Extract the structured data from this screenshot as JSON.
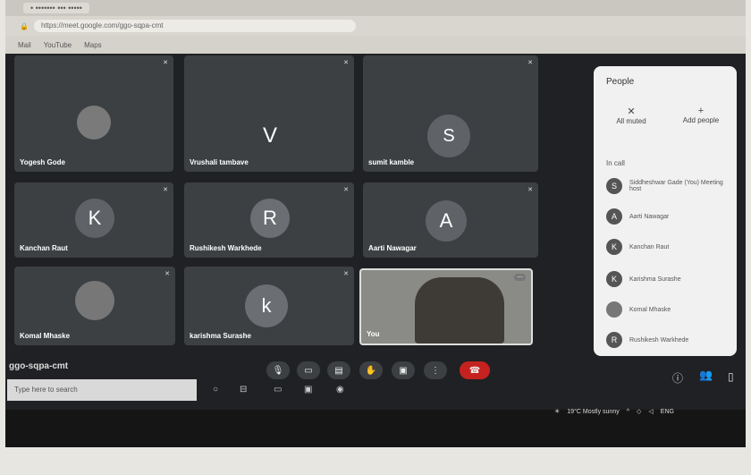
{
  "browser": {
    "tab_title": "• ••••••• ••• •••••",
    "address": "https://meet.google.com/ggo-sqpa-cmt",
    "bookmarks": [
      "Mail",
      "YouTube",
      "Maps"
    ]
  },
  "tiles": [
    {
      "name": "Yogesh Gode",
      "initial": ""
    },
    {
      "name": "Vrushali tambave",
      "initial": "V"
    },
    {
      "name": "sumit kamble",
      "initial": "S"
    },
    {
      "name": "Kanchan Raut",
      "initial": "K"
    },
    {
      "name": "Rushikesh Warkhede",
      "initial": "R"
    },
    {
      "name": "Aarti Nawagar",
      "initial": "A"
    },
    {
      "name": "Komal Mhaske",
      "initial": ""
    },
    {
      "name": "karishma Surashe",
      "initial": "k"
    },
    {
      "name": "You",
      "initial": ""
    }
  ],
  "people_panel": {
    "title": "People",
    "mute_all": "All muted",
    "add_people": "Add people",
    "in_call": "In call",
    "participants": [
      {
        "initial": "S",
        "name": "Siddheshwar Gade (You) Meeting host"
      },
      {
        "initial": "A",
        "name": "Aarti Nawagar"
      },
      {
        "initial": "K",
        "name": "Kanchan Raut"
      },
      {
        "initial": "K",
        "name": "Karishma Surashe"
      },
      {
        "initial": "",
        "name": "Komal Mhaske"
      },
      {
        "initial": "R",
        "name": "Rushikesh Warkhede"
      }
    ]
  },
  "meeting": {
    "code": "ggo-sqpa-cmt"
  },
  "taskbar": {
    "search_placeholder": "Type here to search",
    "weather": "19°C  Mostly sunny",
    "lang": "ENG"
  },
  "colors": {
    "avatar_gray": "#5f6368",
    "end_call": "#c5221f",
    "panel_bg": "#f1f1f1"
  }
}
